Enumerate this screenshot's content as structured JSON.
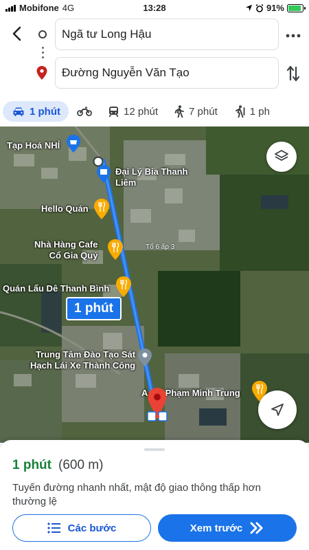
{
  "status_bar": {
    "carrier": "Mobifone",
    "network": "4G",
    "time": "13:28",
    "battery_percent": "91%",
    "battery_level": 0.91
  },
  "route": {
    "origin": "Ngã tư Long Hậu",
    "destination": "Đường Nguyễn Văn Tạo",
    "back_icon": "back-arrow-icon",
    "more_icon": "more-horizontal-icon",
    "swap_icon": "swap-vertical-icon"
  },
  "modes": [
    {
      "icon": "car-icon",
      "label": "1 phút",
      "active": true
    },
    {
      "icon": "motorbike-icon",
      "label": "",
      "active": false
    },
    {
      "icon": "transit-icon",
      "label": "12 phút",
      "active": false
    },
    {
      "icon": "walk-icon",
      "label": "7 phút",
      "active": false
    },
    {
      "icon": "ride-icon",
      "label": "1 ph",
      "active": false
    }
  ],
  "map": {
    "pois": {
      "tap_hoa": "Tạp Hoá NHỈ",
      "dai_ly": "Đại Lý Bia Thanh\nLiêm",
      "hello_quan": "Hello Quán",
      "nha_hang": "Nhà Hàng Cafe\nCổ Gia Quý",
      "quan_lau": "Quán Lẩu Dê Thanh Bình",
      "trung_tam": "Trung Tâm Đào Tạo Sát\nHạch Lái Xe Thành Công",
      "pham_minh_trung": "A... ả Phạm Minh Trung",
      "to_6": "Tổ 6 ấp 3"
    },
    "route_duration_callout": "1 phút",
    "route_color": "#1a73e8",
    "layers_icon": "layers-icon",
    "locate_icon": "navigation-arrow-icon"
  },
  "sheet": {
    "duration": "1 phút",
    "distance": "(600 m)",
    "description": "Tuyến đường nhanh nhất, mật độ giao thông thấp hơn thường lệ",
    "steps_label": "Các bước",
    "preview_label": "Xem trước",
    "steps_icon": "list-icon",
    "preview_icon": "double-chevron-right-icon"
  },
  "colors": {
    "accent": "#1a73e8",
    "duration_green": "#188038",
    "active_tab_bg": "#dde8fb",
    "pin_red": "#ea4335",
    "food_pin": "#f9ab00"
  }
}
